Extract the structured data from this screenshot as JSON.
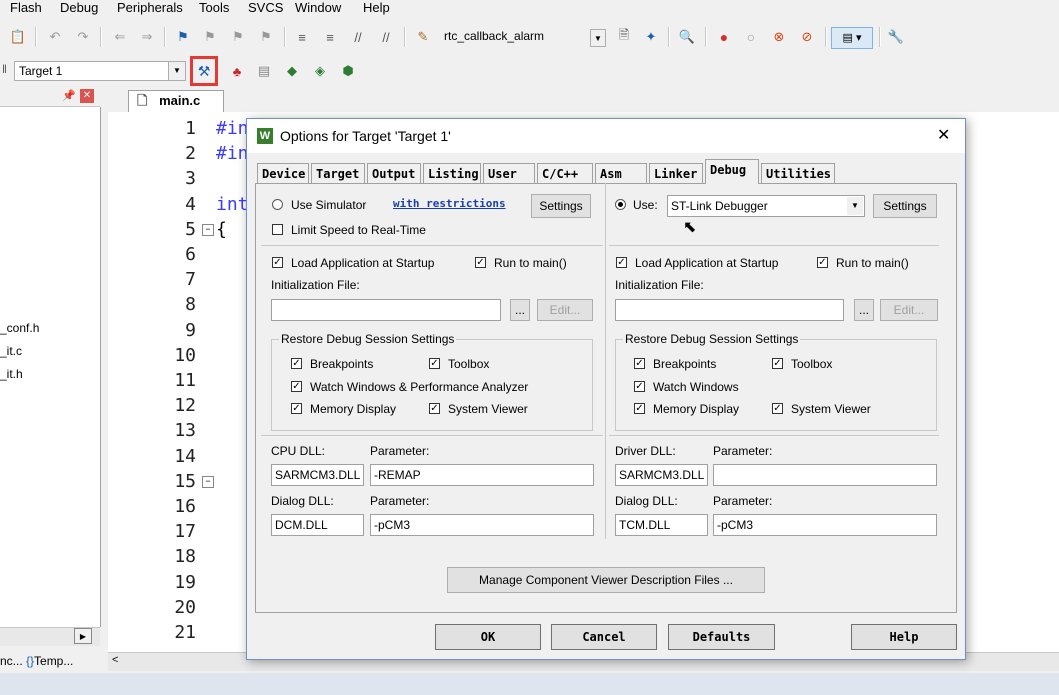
{
  "menu": [
    "Flash",
    "Debug",
    "Peripherals",
    "Tools",
    "SVCS",
    "Window",
    "Help"
  ],
  "toolbar": {
    "target_function": "rtc_callback_alarm",
    "target_select": "Target 1"
  },
  "editor": {
    "tab_label": "main.c",
    "line_numbers": [
      "1",
      "2",
      "3",
      "4",
      "5",
      "6",
      "7",
      "8",
      "9",
      "10",
      "11",
      "12",
      "13",
      "14",
      "15",
      "16",
      "17",
      "18",
      "19",
      "20",
      "21"
    ],
    "code_fragments": [
      "#in",
      "#in",
      "int",
      "{"
    ]
  },
  "project_files": [
    "_conf.h",
    "_it.c",
    "_it.h"
  ],
  "bottom_tabs": [
    "nc...",
    "Temp..."
  ],
  "dialog": {
    "title": "Options for Target 'Target 1'",
    "tabs": [
      "Device",
      "Target",
      "Output",
      "Listing",
      "User",
      "C/C++",
      "Asm",
      "Linker",
      "Debug",
      "Utilities"
    ],
    "active_tab": "Debug",
    "left": {
      "use_simulator": "Use Simulator",
      "restrictions_link": "with restrictions",
      "settings_button": "Settings",
      "limit_speed": "Limit Speed to Real-Time",
      "load_app": "Load Application at Startup",
      "run_to_main": "Run to main()",
      "init_file_label": "Initialization File:",
      "browse": "...",
      "edit": "Edit...",
      "restore_group": "Restore Debug Session Settings",
      "breakpoints": "Breakpoints",
      "toolbox": "Toolbox",
      "watch_windows": "Watch Windows & Performance Analyzer",
      "memory_display": "Memory Display",
      "system_viewer": "System Viewer",
      "cpu_dll_label": "CPU DLL:",
      "cpu_param_label": "Parameter:",
      "cpu_dll": "SARMCM3.DLL",
      "cpu_param": "-REMAP",
      "dialog_dll_label": "Dialog DLL:",
      "dialog_param_label": "Parameter:",
      "dialog_dll": "DCM.DLL",
      "dialog_param": "-pCM3"
    },
    "right": {
      "use": "Use:",
      "debugger": "ST-Link Debugger",
      "settings_button": "Settings",
      "load_app": "Load Application at Startup",
      "run_to_main": "Run to main()",
      "init_file_label": "Initialization File:",
      "browse": "...",
      "edit": "Edit...",
      "restore_group": "Restore Debug Session Settings",
      "breakpoints": "Breakpoints",
      "toolbox": "Toolbox",
      "watch_windows": "Watch Windows",
      "memory_display": "Memory Display",
      "system_viewer": "System Viewer",
      "driver_dll_label": "Driver DLL:",
      "driver_param_label": "Parameter:",
      "driver_dll": "SARMCM3.DLL",
      "driver_param": "",
      "dialog_dll_label": "Dialog DLL:",
      "dialog_param_label": "Parameter:",
      "dialog_dll": "TCM.DLL",
      "dialog_param": "-pCM3"
    },
    "manage_button": "Manage Component Viewer Description Files ...",
    "ok": "OK",
    "cancel": "Cancel",
    "defaults": "Defaults",
    "help": "Help",
    "close": "✕"
  },
  "colors": {
    "highlight_box": "#e53935",
    "code_blue": "#3c3cff",
    "link": "#1a3fa8"
  }
}
